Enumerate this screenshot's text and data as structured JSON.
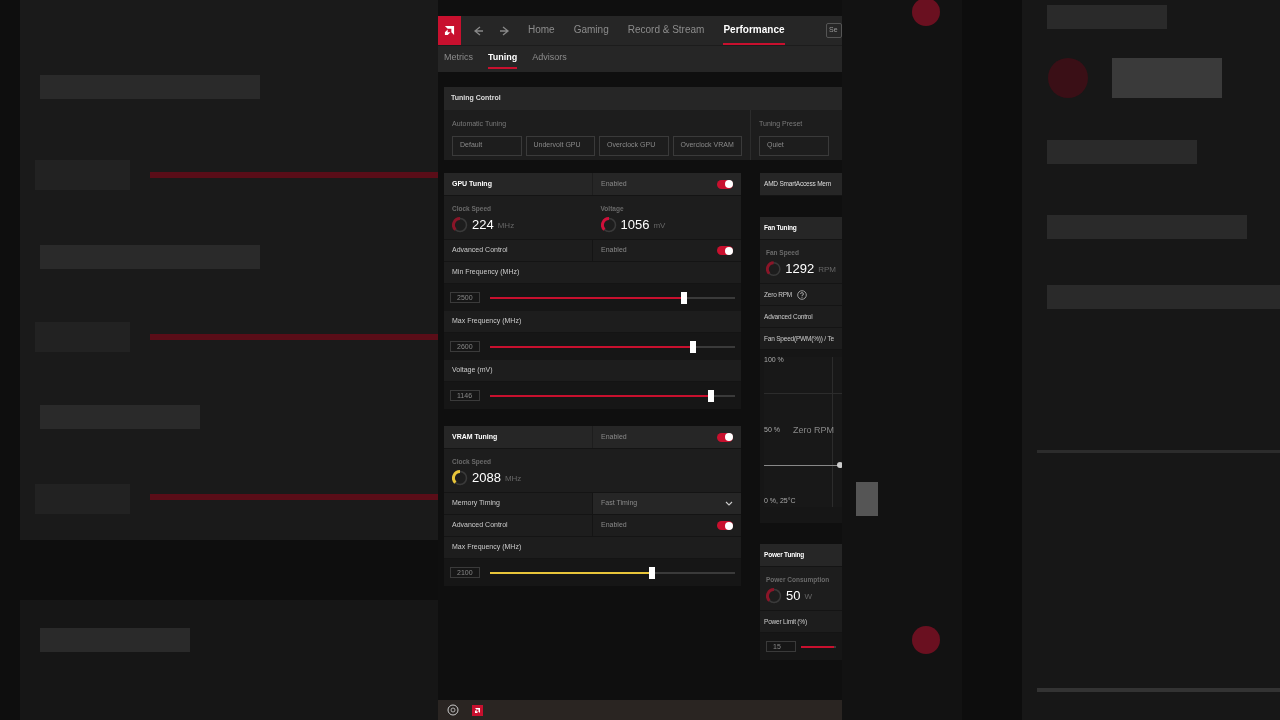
{
  "nav": {
    "tabs": [
      {
        "label": "Home",
        "selected": false
      },
      {
        "label": "Gaming",
        "selected": false
      },
      {
        "label": "Record & Stream",
        "selected": false
      },
      {
        "label": "Performance",
        "selected": true
      }
    ],
    "search_button": "Se"
  },
  "subtabs": [
    {
      "label": "Metrics",
      "selected": false
    },
    {
      "label": "Tuning",
      "selected": true
    },
    {
      "label": "Advisors",
      "selected": false
    }
  ],
  "tuning_control": {
    "title": "Tuning Control",
    "groups": [
      {
        "label": "Automatic Tuning",
        "buttons": [
          "Default",
          "Undervolt GPU",
          "Overclock GPU",
          "Overclock VRAM"
        ]
      },
      {
        "label": "Tuning Preset",
        "buttons": [
          "Quiet"
        ]
      }
    ]
  },
  "left_cards": [
    {
      "title": "GPU Tuning",
      "state_label": "Enabled",
      "on": true,
      "rows": [
        {
          "kind": "metrics",
          "items": [
            {
              "label": "Clock Speed",
              "value": "224",
              "unit": "MHz",
              "color": "#8a1528"
            },
            {
              "label": "Voltage",
              "value": "1056",
              "unit": "mV",
              "color": "#d0103a"
            }
          ]
        },
        {
          "kind": "toggle",
          "label": "Advanced Control",
          "state_label": "Enabled",
          "on": true
        },
        {
          "kind": "label",
          "label": "Min Frequency (MHz)"
        },
        {
          "kind": "slider",
          "value": "2500",
          "level": 0.79,
          "color": "#c8102e"
        },
        {
          "kind": "label",
          "label": "Max Frequency (MHz)"
        },
        {
          "kind": "slider",
          "value": "2600",
          "level": 0.83,
          "color": "#c8102e"
        },
        {
          "kind": "label",
          "label": "Voltage (mV)"
        },
        {
          "kind": "slider",
          "value": "1146",
          "level": 0.9,
          "color": "#c8102e"
        }
      ]
    },
    {
      "title": "VRAM Tuning",
      "state_label": "Enabled",
      "on": true,
      "rows": [
        {
          "kind": "metrics",
          "items": [
            {
              "label": "Clock Speed",
              "value": "2088",
              "unit": "MHz",
              "color": "#e8c53a"
            }
          ]
        },
        {
          "kind": "dropdown",
          "label": "Memory Timing",
          "value": "Fast Timing"
        },
        {
          "kind": "toggle",
          "label": "Advanced Control",
          "state_label": "Enabled",
          "on": true
        },
        {
          "kind": "label",
          "label": "Max Frequency (MHz)"
        },
        {
          "kind": "slider",
          "value": "2100",
          "level": 0.66,
          "color": "#e8c53a"
        }
      ]
    }
  ],
  "right_cards": [
    {
      "title": "AMD SmartAccess Mem"
    },
    {
      "title": "Fan Tuning",
      "rows": [
        {
          "kind": "metrics",
          "items": [
            {
              "label": "Fan Speed",
              "value": "1292",
              "unit": "RPM",
              "color": "#8a1528"
            }
          ]
        },
        {
          "kind": "help",
          "label": "Zero RPM"
        },
        {
          "kind": "label",
          "label": "Advanced Control"
        },
        {
          "kind": "label",
          "label": "Fan Speed(PWM(%)) / Te"
        },
        {
          "kind": "curve",
          "top_label": "100 %",
          "mid_label": "50 %",
          "zone_label": "Zero RPM",
          "bottom_label": "0 %, 25°C"
        }
      ]
    },
    {
      "title": "Power Tuning",
      "rows": [
        {
          "kind": "metrics",
          "items": [
            {
              "label": "Power Consumption",
              "value": "50",
              "unit": "W",
              "color": "#8a1528"
            }
          ]
        },
        {
          "kind": "label",
          "label": "Power Limit (%)"
        },
        {
          "kind": "slider",
          "value": "15",
          "level": 0.95,
          "color": "#c8102e"
        }
      ]
    }
  ]
}
